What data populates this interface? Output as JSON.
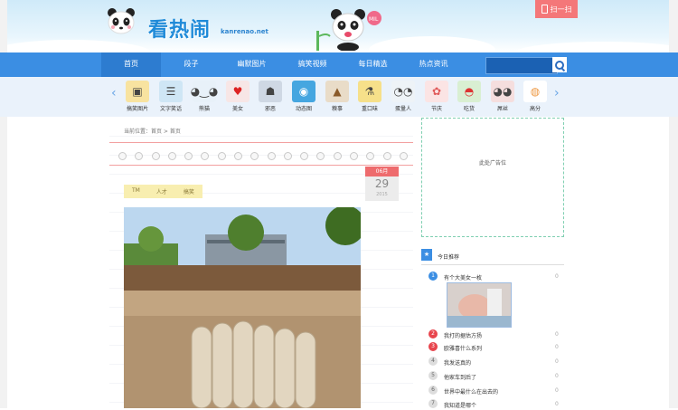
{
  "header": {
    "logo_text": "看热闹",
    "logo_sub": "kanrenao.net",
    "login_label": "扫一扫"
  },
  "nav": {
    "items": [
      "首页",
      "段子",
      "幽默图片",
      "搞笑视频",
      "每日精选",
      "热点资讯"
    ],
    "active_index": 0,
    "search_placeholder": ""
  },
  "categories": [
    {
      "label": "搞笑图片",
      "icon": "image-icon"
    },
    {
      "label": "文字笑话",
      "icon": "text-icon"
    },
    {
      "label": "熊猫",
      "icon": "panda-icon"
    },
    {
      "label": "美女",
      "icon": "lips-icon"
    },
    {
      "label": "邪恶",
      "icon": "devil-icon"
    },
    {
      "label": "动态图",
      "icon": "camera-icon"
    },
    {
      "label": "糗事",
      "icon": "poop-icon"
    },
    {
      "label": "重口味",
      "icon": "flask-icon"
    },
    {
      "label": "蛋量人",
      "icon": "egg-icon"
    },
    {
      "label": "节庆",
      "icon": "flower-icon"
    },
    {
      "label": "吃货",
      "icon": "watermelon-icon"
    },
    {
      "label": "屌丝",
      "icon": "pig-icon"
    },
    {
      "label": "高分",
      "icon": "palette-icon"
    }
  ],
  "article": {
    "breadcrumb": "当前位置：首页 > 首页",
    "tags": [
      "TM",
      "人才",
      "搞笑"
    ],
    "date": {
      "month": "06月",
      "day": "29",
      "year": "2015"
    }
  },
  "ad": {
    "text": "此处广告位"
  },
  "recommend": {
    "title": "今日推荐",
    "items": [
      {
        "num": "1",
        "text": "有个大美女一枚",
        "count": "0"
      },
      {
        "num": "2",
        "text": "我打的据估方扬",
        "count": "0"
      },
      {
        "num": "3",
        "text": "欧雅喜什么系列",
        "count": "0"
      },
      {
        "num": "4",
        "text": "我发送真的",
        "count": "0"
      },
      {
        "num": "5",
        "text": "他家车到后了",
        "count": "0"
      },
      {
        "num": "6",
        "text": "世界中最什么在出去的",
        "count": "0"
      },
      {
        "num": "7",
        "text": "我知道是哪个",
        "count": "0"
      }
    ]
  }
}
